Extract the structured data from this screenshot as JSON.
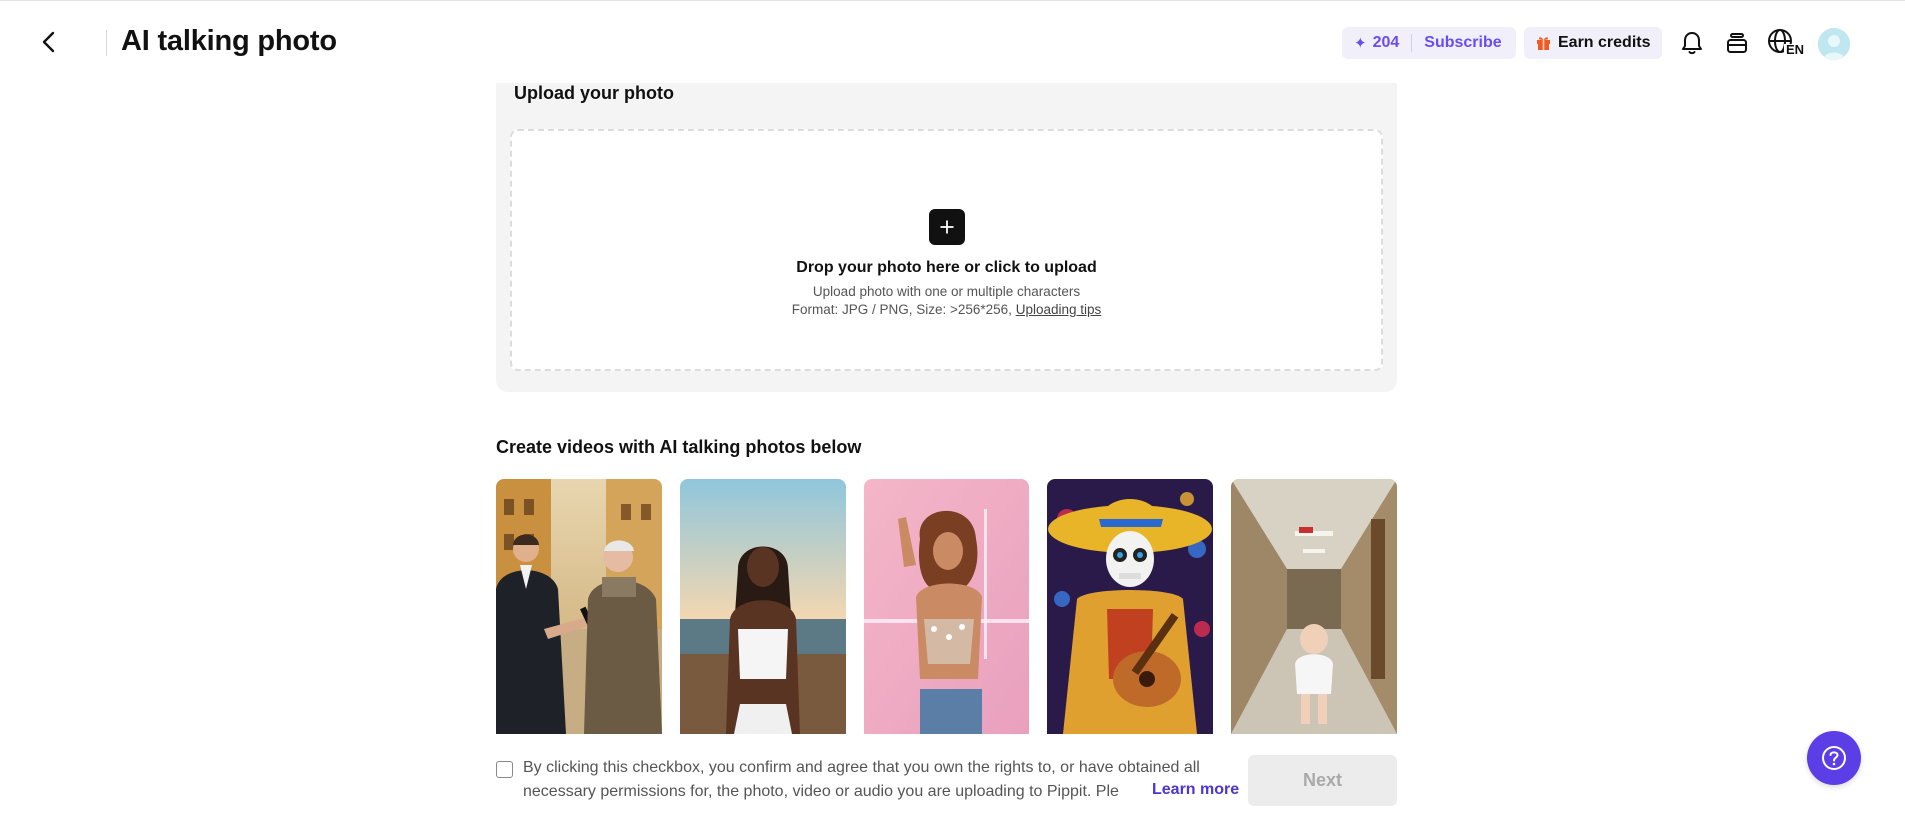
{
  "header": {
    "title": "AI talking photo",
    "back_icon": "chevron-left-icon",
    "credits_count": "204",
    "subscribe_label": "Subscribe",
    "earn_label": "Earn credits",
    "language_badge": "EN",
    "icons": [
      "sparkle-icon",
      "gift-icon",
      "bell-icon",
      "stack-icon",
      "globe-icon",
      "avatar"
    ]
  },
  "upload": {
    "heading": "Upload your photo",
    "drop_title": "Drop your photo here or click to upload",
    "drop_subtitle": "Upload photo with one or multiple characters",
    "format_text": "Format: JPG / PNG, Size: >256*256,",
    "tips_link": "Uploading tips"
  },
  "examples": {
    "title": "Create videos with AI talking photos below",
    "items": [
      {
        "name": "interview-street"
      },
      {
        "name": "beach-sunset-woman"
      },
      {
        "name": "dancing-woman-neon"
      },
      {
        "name": "skeleton-mariachi-guitar"
      },
      {
        "name": "baby-hallway"
      }
    ]
  },
  "footer": {
    "consent_line1": "By clicking this checkbox, you confirm and agree that you own the rights to, or have obtained all",
    "consent_line2": "necessary permissions for, the photo, video or audio you are uploading to Pippit. Ple",
    "learn_more": "Learn more",
    "next_label": "Next",
    "consent_checked": false
  },
  "colors": {
    "accent": "#6a4cf0",
    "link": "#4a35d6",
    "help_fab": "#5b3ee6",
    "panel_bg": "#f4f4f4"
  }
}
